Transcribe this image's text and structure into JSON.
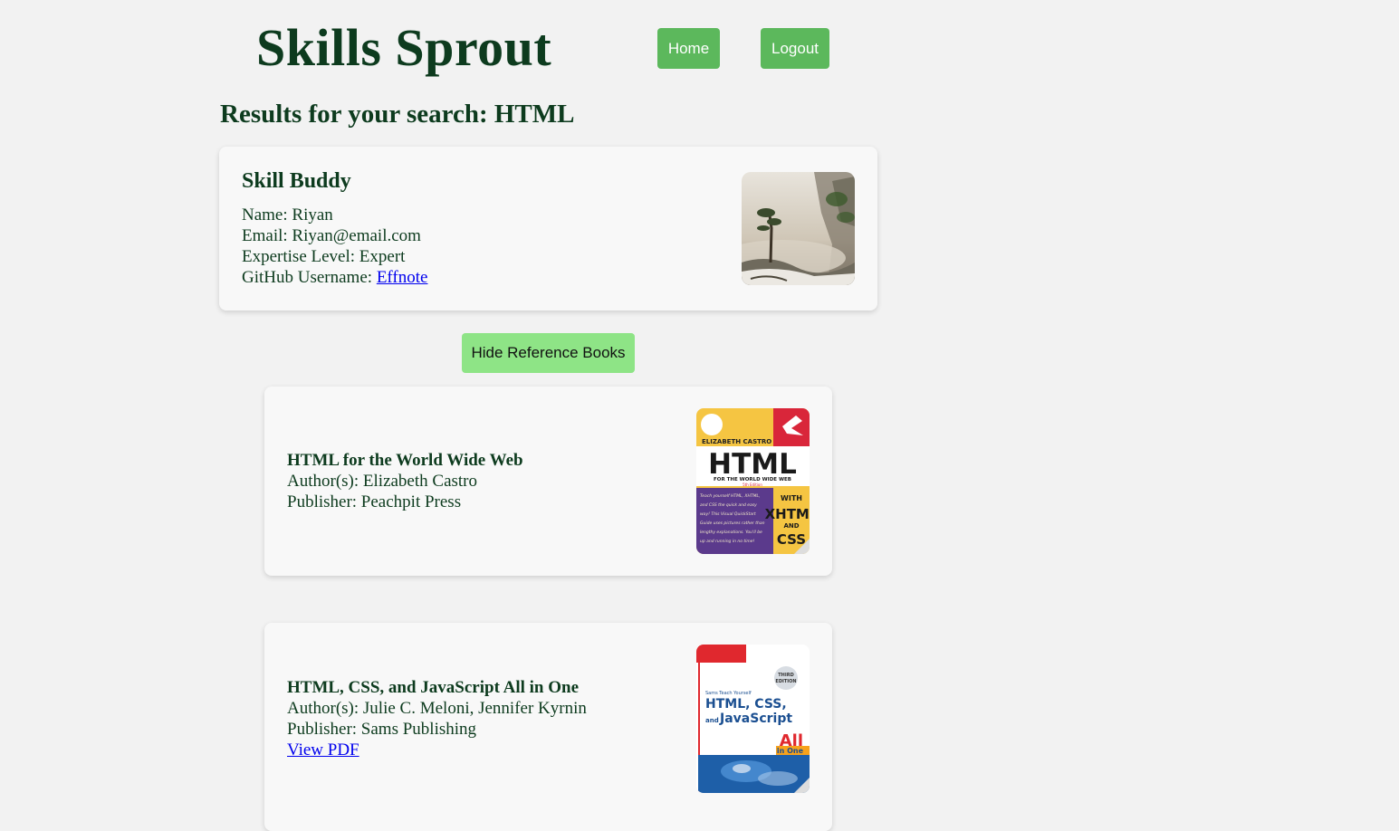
{
  "header": {
    "site_title": "Skills Sprout",
    "home_label": "Home",
    "logout_label": "Logout"
  },
  "results": {
    "heading": "Results for your search: HTML"
  },
  "buddy": {
    "title": "Skill Buddy",
    "name_label": "Name: Riyan",
    "email_label": "Email: Riyan@email.com",
    "expertise_label": "Expertise Level: Expert",
    "github_prefix": "GitHub Username: ",
    "github_username": "Effnote",
    "photo": "landscape-photo"
  },
  "toggle_books_label": "Hide Reference Books",
  "books": [
    {
      "title": "HTML for the World Wide Web",
      "authors": "Author(s): Elizabeth Castro",
      "publisher": "Publisher: Peachpit Press",
      "cover": {
        "author": "ELIZABETH CASTRO",
        "big": "HTML",
        "sub": "FOR THE WORLD WIDE WEB",
        "edition": "5th Edition",
        "side": [
          "WITH",
          "XHTML",
          "AND",
          "CSS"
        ],
        "blurb": [
          "Teach yourself HTML, XHTML,",
          "and CSS the quick and easy",
          "way! This Visual QuickStart",
          "Guide uses pictures rather than",
          "lengthy explanations. You'll be",
          "up and running in no time!"
        ]
      }
    },
    {
      "title": "HTML, CSS, and JavaScript All in One",
      "authors": "Author(s): Julie C. Meloni, Jennifer Kyrnin",
      "publisher": "Publisher: Sams Publishing",
      "pdf_label": "View PDF",
      "cover": {
        "series": "Sams Teach Yourself",
        "line1": "HTML, CSS,",
        "line2_small": "and",
        "line2": "JavaScript",
        "all": "All",
        "in_one": "in One",
        "edition_1": "THIRD",
        "edition_2": "EDITION"
      }
    }
  ],
  "colors": {
    "title_green": "#0d3b1e",
    "nav_button": "#5cb85c",
    "toggle_button": "#8ee486",
    "background": "#f2f2f2"
  }
}
